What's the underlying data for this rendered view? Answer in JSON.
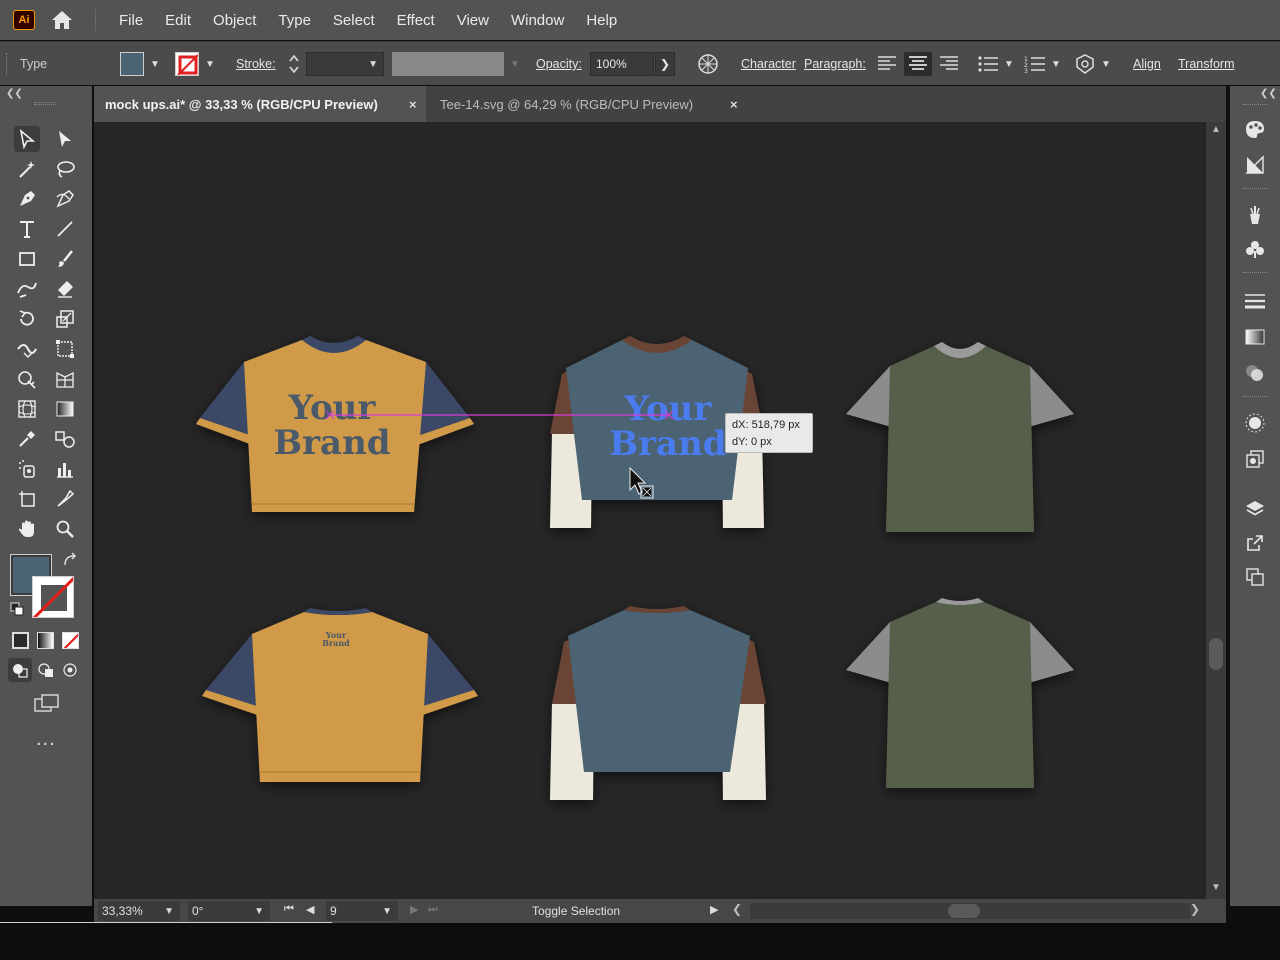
{
  "app": {
    "logo_text": "Ai",
    "home_icon": "home-icon"
  },
  "menu": [
    "File",
    "Edit",
    "Object",
    "Type",
    "Select",
    "Effect",
    "View",
    "Window",
    "Help"
  ],
  "control_bar": {
    "mode_label": "Type",
    "fill_color": "#4b6473",
    "stroke_label": "Stroke:",
    "opacity_label": "Opacity:",
    "opacity_value": "100%",
    "character_label": "Character",
    "paragraph_label": "Paragraph:",
    "align_label": "Align",
    "transform_label": "Transform"
  },
  "tabs": [
    {
      "title": "mock ups.ai* @ 33,33 % (RGB/CPU Preview)",
      "active": true,
      "close": "×"
    },
    {
      "title": "Tee-14.svg @ 64,29 % (RGB/CPU Preview)",
      "active": false,
      "close": "×"
    }
  ],
  "canvas": {
    "brand_line1": "Your",
    "brand_line2": "Brand",
    "small_brand_line1": "Your",
    "small_brand_line2": "Brand",
    "measure_dx": "dX: 518,79 px",
    "measure_dy": "dY: 0 px",
    "colors": {
      "mustard": "#d09a4a",
      "navy": "#3a4866",
      "slate": "#4b6473",
      "brown": "#6b4435",
      "cream": "#ece8dc",
      "olive": "#575e48",
      "grey_sleeve": "#8c8c8c",
      "brand_text": "#4a5a6a",
      "selected_text": "#4a7bef",
      "guide_line": "#d93ad9"
    }
  },
  "status_bar": {
    "zoom": "33,33%",
    "rotation": "0°",
    "artboard": "9",
    "status_text": "Toggle Selection"
  },
  "left_toolbar": {
    "fill_swatch": "#4b6473",
    "more_label": "..."
  }
}
